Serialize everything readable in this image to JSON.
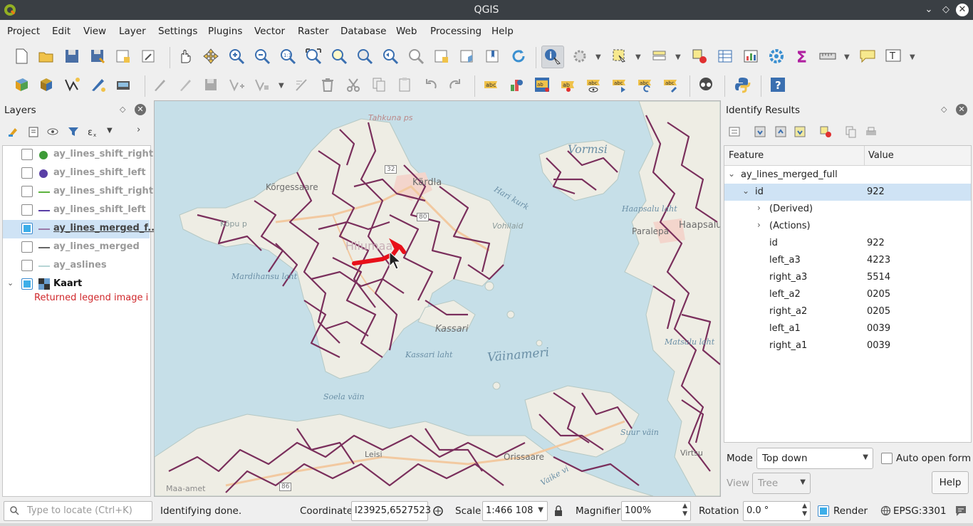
{
  "window": {
    "title": "QGIS"
  },
  "menubar": [
    "Project",
    "Edit",
    "View",
    "Layer",
    "Settings",
    "Plugins",
    "Vector",
    "Raster",
    "Database",
    "Web",
    "Processing",
    "Help"
  ],
  "layers_panel": {
    "title": "Layers",
    "layers": [
      {
        "name": "ay_lines_shift_right",
        "checked": false,
        "symbol": "point",
        "color": "#3d9b37",
        "active": false
      },
      {
        "name": "ay_lines_shift_left",
        "checked": false,
        "symbol": "point",
        "color": "#5a3fa6",
        "active": false
      },
      {
        "name": "ay_lines_shift_right",
        "checked": false,
        "symbol": "line",
        "color": "#5db33e",
        "active": false
      },
      {
        "name": "ay_lines_shift_left",
        "checked": false,
        "symbol": "line",
        "color": "#5a3fa6",
        "active": false
      },
      {
        "name": "ay_lines_merged_f...",
        "checked": true,
        "symbol": "line",
        "color": "#9a7aa8",
        "active": true
      },
      {
        "name": "ay_lines_merged",
        "checked": false,
        "symbol": "line",
        "color": "#333333",
        "active": false
      },
      {
        "name": "ay_aslines",
        "checked": false,
        "symbol": "line",
        "color": "#9fc7c7",
        "active": false
      }
    ],
    "group": {
      "name": "Kaart",
      "checked": true,
      "expanded": true
    },
    "legend_error": "Returned legend image i"
  },
  "map": {
    "labels_water": [
      "Vormsi",
      "Hari kurk",
      "Haapsalu laht",
      "Mardihansu laht",
      "Kassari laht",
      "Väinameri",
      "Soela väin",
      "Suur väin",
      "Matsalu laht",
      "Vaike vi"
    ],
    "labels_place": [
      "Tahkuna ps",
      "Kõrgessaare",
      "Kärdla",
      "Vohilaid",
      "Hiiumaa",
      "Kassari",
      "Leisi",
      "Orissaare",
      "Paralepa",
      "Haapsalu",
      "Virtsu",
      "Kõpu p",
      "Maa-amet",
      "32",
      "80",
      "86"
    ],
    "route_color": "#e8101a",
    "line_color": "#7a2f5c"
  },
  "identify_panel": {
    "title": "Identify Results",
    "columns": [
      "Feature",
      "Value"
    ],
    "root": "ay_lines_merged_full",
    "rows": [
      {
        "field": "id",
        "value": "922",
        "selected": true
      },
      {
        "field": "(Derived)",
        "value": ""
      },
      {
        "field": "(Actions)",
        "value": ""
      },
      {
        "field": "id",
        "value": "922"
      },
      {
        "field": "left_a3",
        "value": "4223"
      },
      {
        "field": "right_a3",
        "value": "5514"
      },
      {
        "field": "left_a2",
        "value": "0205"
      },
      {
        "field": "right_a2",
        "value": "0205"
      },
      {
        "field": "left_a1",
        "value": "0039"
      },
      {
        "field": "right_a1",
        "value": "0039"
      }
    ],
    "mode_label": "Mode",
    "mode_value": "Top down",
    "auto_open_label": "Auto open form",
    "view_label": "View",
    "view_value": "Tree",
    "help_label": "Help"
  },
  "statusbar": {
    "search_placeholder": "Type to locate (Ctrl+K)",
    "message": "Identifying done.",
    "coordinate_label": "Coordinate",
    "coordinate_value": "l23925,6527523",
    "scale_label": "Scale",
    "scale_value": "1:466 108",
    "magnifier_label": "Magnifier",
    "magnifier_value": "100%",
    "rotation_label": "Rotation",
    "rotation_value": "0.0 °",
    "render_label": "Render",
    "crs_value": "EPSG:3301"
  }
}
